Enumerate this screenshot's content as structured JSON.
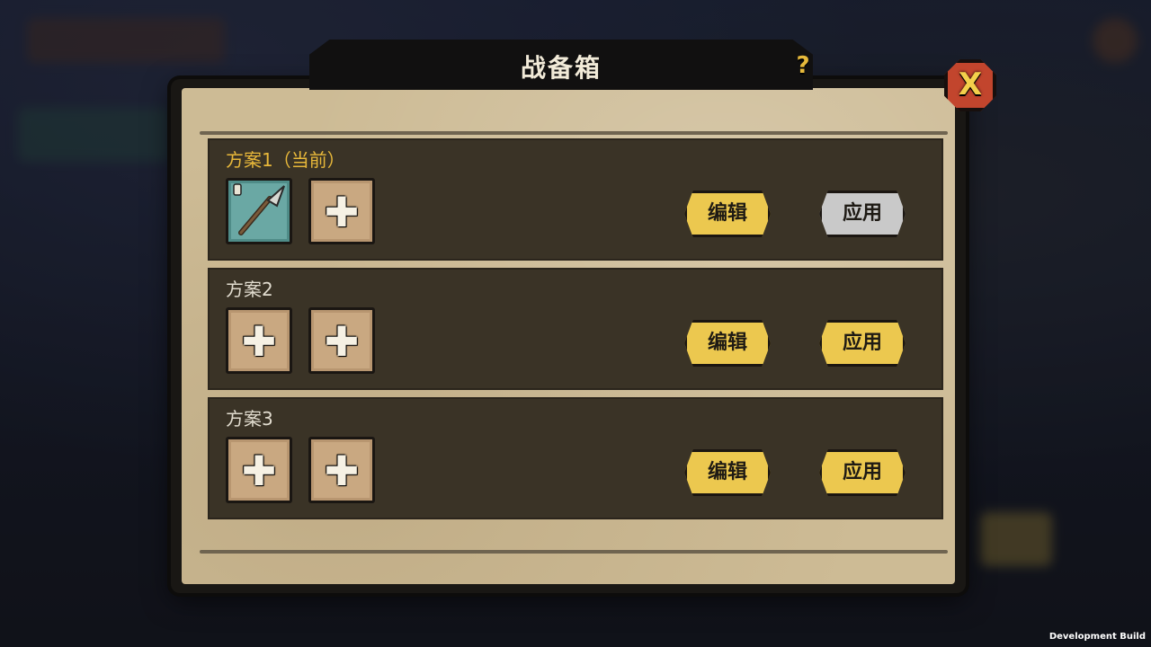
{
  "dialog": {
    "title": "战备箱",
    "help_glyph": "?",
    "close_glyph": "X"
  },
  "plans": [
    {
      "label": "方案1（当前）",
      "current": true,
      "slots": [
        {
          "type": "item",
          "icon": "spear-icon"
        },
        {
          "type": "empty",
          "glyph": "✚"
        }
      ],
      "edit_label": "编辑",
      "apply_label": "应用",
      "apply_enabled": false
    },
    {
      "label": "方案2",
      "current": false,
      "slots": [
        {
          "type": "empty",
          "glyph": "✚"
        },
        {
          "type": "empty",
          "glyph": "✚"
        }
      ],
      "edit_label": "编辑",
      "apply_label": "应用",
      "apply_enabled": true
    },
    {
      "label": "方案3",
      "current": false,
      "slots": [
        {
          "type": "empty",
          "glyph": "✚"
        },
        {
          "type": "empty",
          "glyph": "✚"
        }
      ],
      "edit_label": "编辑",
      "apply_label": "应用",
      "apply_enabled": true
    }
  ],
  "footer": {
    "build_label": "Development Build"
  },
  "colors": {
    "accent_yellow": "#ecc84f",
    "current_label": "#e8b83a",
    "paper": "#cdbb95",
    "row_bg": "#3a3326",
    "close_red": "#c2452d"
  }
}
